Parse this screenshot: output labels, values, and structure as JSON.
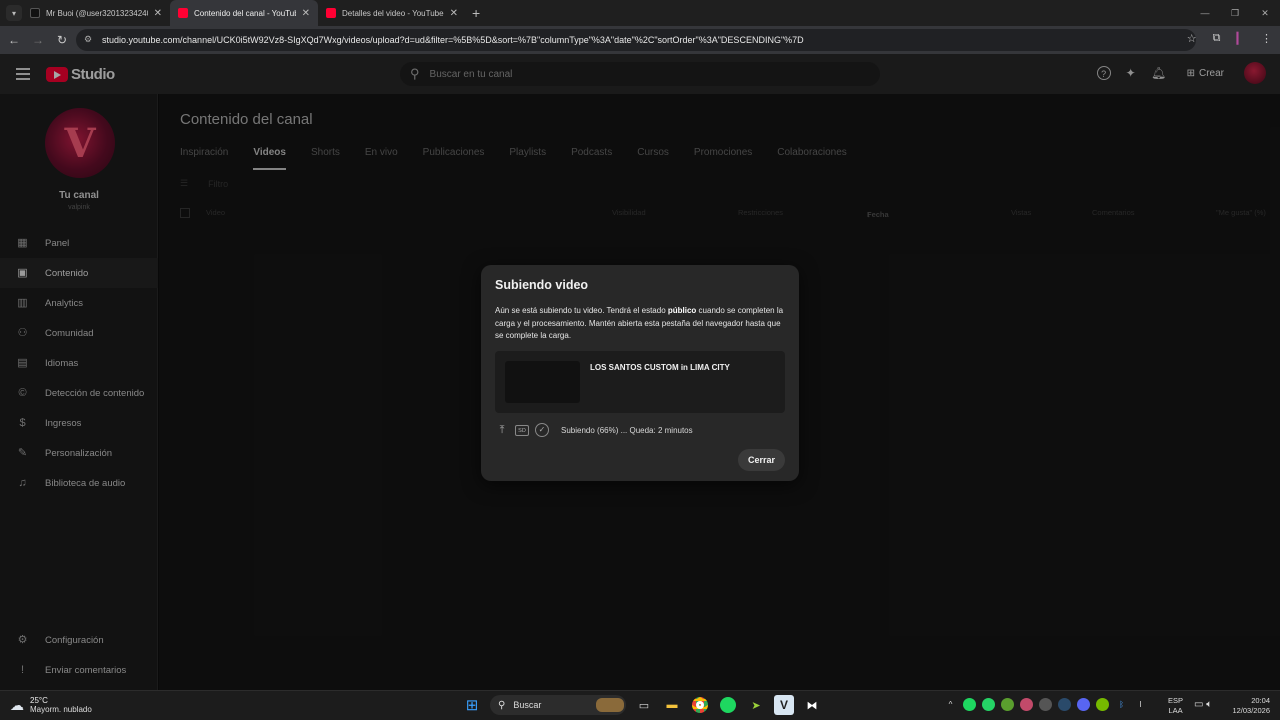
{
  "browser": {
    "tabs": [
      {
        "title": "Mr Buoi (@user3201323424044)",
        "favicon_color": "#000000"
      },
      {
        "title": "Contenido del canal - YouTube Studio",
        "favicon_color": "#ff0033"
      },
      {
        "title": "Detalles del video - YouTube Studio",
        "favicon_color": "#ff0033"
      }
    ],
    "url": "studio.youtube.com/channel/UCK0i5tW92Vz8-SIgXQd7Wxg/videos/upload?d=ud&filter=%5B%5D&sort=%7B\"columnType\"%3A\"date\"%2C\"sortOrder\"%3A\"DESCENDING\"%7D"
  },
  "header": {
    "logo_text": "Studio",
    "search_placeholder": "Buscar en tu canal",
    "create_label": "Crear"
  },
  "sidebar": {
    "channel_title": "Tu canal",
    "channel_sub": "valpink",
    "items": [
      {
        "label": "Panel",
        "icon": "dashboard-icon"
      },
      {
        "label": "Contenido",
        "icon": "content-icon"
      },
      {
        "label": "Analytics",
        "icon": "analytics-icon"
      },
      {
        "label": "Comunidad",
        "icon": "community-icon"
      },
      {
        "label": "Idiomas",
        "icon": "subtitles-icon"
      },
      {
        "label": "Detección de contenido",
        "icon": "copyright-icon"
      },
      {
        "label": "Ingresos",
        "icon": "dollar-icon"
      },
      {
        "label": "Personalización",
        "icon": "magic-wand-icon"
      },
      {
        "label": "Biblioteca de audio",
        "icon": "audio-library-icon"
      }
    ],
    "bottom": [
      {
        "label": "Configuración",
        "icon": "gear-icon"
      },
      {
        "label": "Enviar comentarios",
        "icon": "feedback-icon"
      }
    ]
  },
  "main": {
    "title": "Contenido del canal",
    "tabs": [
      "Inspiración",
      "Videos",
      "Shorts",
      "En vivo",
      "Publicaciones",
      "Playlists",
      "Podcasts",
      "Cursos",
      "Promociones",
      "Colaboraciones"
    ],
    "active_tab": "Videos",
    "filter_placeholder": "Filtro",
    "columns": [
      "Video",
      "Visibilidad",
      "Restricciones",
      "Fecha",
      "Vistas",
      "Comentarios",
      "\"Me gusta\" (%)"
    ]
  },
  "dialog": {
    "title": "Subiendo video",
    "body_pre": "Aún se está subiendo tu video. Tendrá el estado ",
    "body_bold": "público",
    "body_post": " cuando se completen la carga y el procesamiento. Mantén abierta esta pestaña del navegador hasta que se complete la carga.",
    "video_title": "LOS SANTOS CUSTOM in LIMA CITY",
    "sd_badge": "SD",
    "status": "Subiendo (66%) ... Queda: 2 minutos",
    "progress_percent": 66,
    "close_label": "Cerrar"
  },
  "taskbar": {
    "temp": "25°C",
    "weather": "Mayorm. nublado",
    "search_label": "Buscar",
    "lang_line1": "ESP",
    "lang_line2": "LAA",
    "time": "20:04",
    "date": "12/03/2026"
  }
}
